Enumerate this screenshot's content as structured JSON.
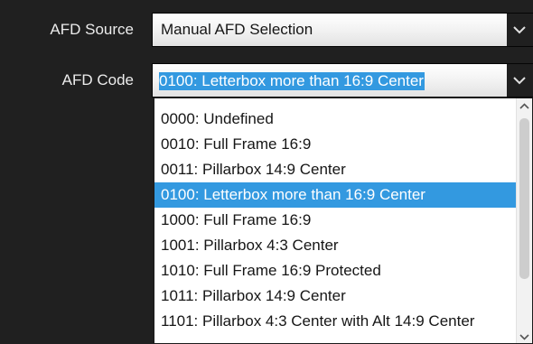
{
  "afd_source": {
    "label": "AFD Source",
    "value": "Manual AFD Selection"
  },
  "afd_code": {
    "label": "AFD Code",
    "value": "0100: Letterbox more than 16:9 Center"
  },
  "dropdown": {
    "selected_index": 3,
    "items": [
      "0000: Undefined",
      "0010: Full Frame 16:9",
      "0011: Pillarbox 14:9 Center",
      "0100: Letterbox more than 16:9 Center",
      "1000: Full Frame 16:9",
      "1001: Pillarbox 4:3 Center",
      "1010: Full Frame 16:9 Protected",
      "1011: Pillarbox 14:9 Center",
      "1101: Pillarbox 4:3 Center with Alt 14:9 Center"
    ]
  },
  "colors": {
    "background": "#202020",
    "selection": "#3399e0",
    "label_text": "#ececec"
  },
  "icons": {
    "dropdown_arrow": "chevron-down-icon",
    "scroll_up": "chevron-up-icon",
    "scroll_down": "chevron-down-icon"
  }
}
